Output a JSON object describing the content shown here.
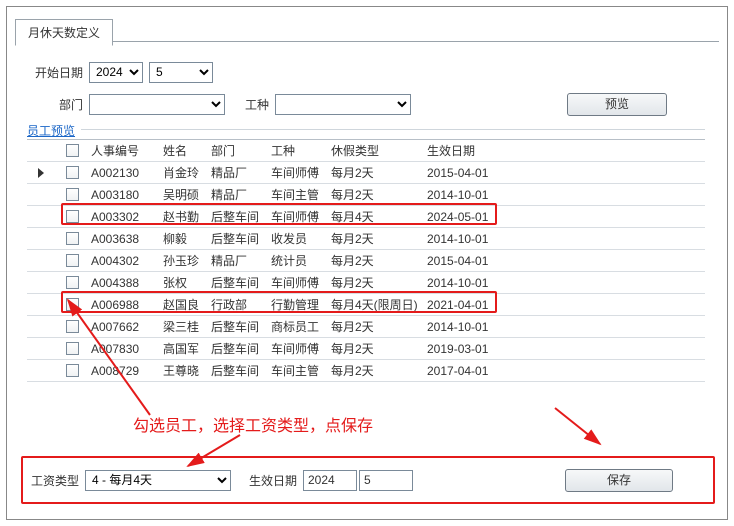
{
  "tab": {
    "title": "月休天数定义"
  },
  "filters": {
    "start_date_label": "开始日期",
    "year": "2024",
    "month": "5",
    "dept_label": "部门",
    "dept": "",
    "job_label": "工种",
    "job": "",
    "preview_btn": "预览"
  },
  "section": {
    "title": "员工预览"
  },
  "grid": {
    "headers": {
      "id": "人事编号",
      "name": "姓名",
      "dept": "部门",
      "job": "工种",
      "type": "休假类型",
      "date": "生效日期"
    },
    "rows": [
      {
        "id": "A002130",
        "name": "肖金玲",
        "dept": "精品厂",
        "job": "车间师傅",
        "type": "每月2天",
        "date": "2015-04-01",
        "ptr": true
      },
      {
        "id": "A003180",
        "name": "吴明硕",
        "dept": "精品厂",
        "job": "车间主管",
        "type": "每月2天",
        "date": "2014-10-01"
      },
      {
        "id": "A003302",
        "name": "赵书勤",
        "dept": "后整车间",
        "job": "车间师傅",
        "type": "每月4天",
        "date": "2024-05-01"
      },
      {
        "id": "A003638",
        "name": "柳毅",
        "dept": "后整车间",
        "job": "收发员",
        "type": "每月2天",
        "date": "2014-10-01"
      },
      {
        "id": "A004302",
        "name": "孙玉珍",
        "dept": "精品厂",
        "job": "统计员",
        "type": "每月2天",
        "date": "2015-04-01"
      },
      {
        "id": "A004388",
        "name": "张权",
        "dept": "后整车间",
        "job": "车间师傅",
        "type": "每月2天",
        "date": "2014-10-01"
      },
      {
        "id": "A006988",
        "name": "赵国良",
        "dept": "行政部",
        "job": "行勤管理",
        "type": "每月4天(限周日)",
        "date": "2021-04-01"
      },
      {
        "id": "A007662",
        "name": "梁三桂",
        "dept": "后整车间",
        "job": "商标员工",
        "type": "每月2天",
        "date": "2014-10-01"
      },
      {
        "id": "A007830",
        "name": "高国军",
        "dept": "后整车间",
        "job": "车间师傅",
        "type": "每月2天",
        "date": "2019-03-01"
      },
      {
        "id": "A008729",
        "name": "王尊晓",
        "dept": "后整车间",
        "job": "车间主管",
        "type": "每月2天",
        "date": "2017-04-01"
      }
    ]
  },
  "annotation": "勾选员工，选择工资类型，点保存",
  "bottom": {
    "salary_label": "工资类型",
    "salary_value": "4 - 每月4天",
    "eff_label": "生效日期",
    "eff_year": "2024",
    "eff_month": "5",
    "save_btn": "保存"
  }
}
